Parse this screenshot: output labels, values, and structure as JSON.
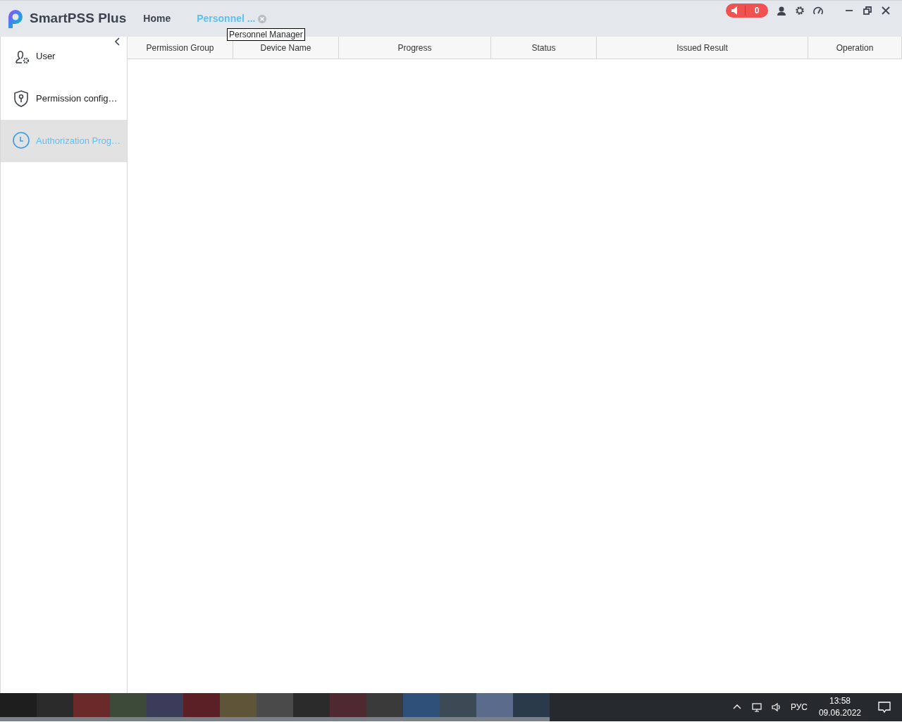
{
  "app": {
    "title": "SmartPSS Plus"
  },
  "tabs": [
    {
      "label": "Home",
      "selected": false,
      "closable": false
    },
    {
      "label": "Personnel ...",
      "selected": true,
      "closable": true
    }
  ],
  "tooltip": "Personnel Manager",
  "alarm": {
    "count": "0"
  },
  "sidebar": {
    "items": [
      {
        "label": "User",
        "kind": "user",
        "selected": false
      },
      {
        "label": "Permission config…",
        "kind": "shield",
        "selected": false
      },
      {
        "label": "Authorization Prog…",
        "kind": "clock",
        "selected": true
      }
    ]
  },
  "table": {
    "columns": [
      "Permission Group",
      "Device Name",
      "Progress",
      "Status",
      "Issued Result",
      "Operation"
    ]
  },
  "taskbar": {
    "language": "РУС",
    "time": "13:58",
    "date": "09.06.2022"
  }
}
